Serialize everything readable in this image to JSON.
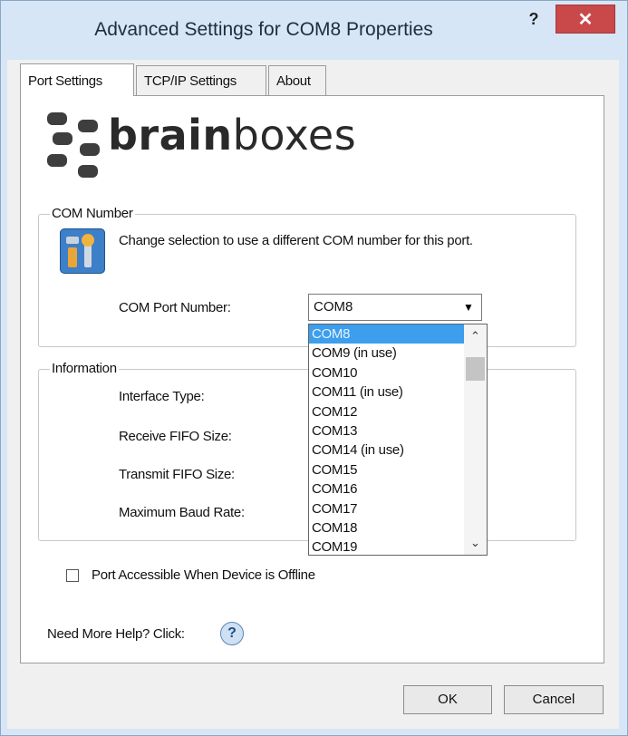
{
  "window": {
    "title": "Advanced Settings for COM8 Properties",
    "help_label": "?",
    "close_label": "✕"
  },
  "tabs": [
    {
      "label": "Port Settings"
    },
    {
      "label": "TCP/IP Settings"
    },
    {
      "label": "About"
    }
  ],
  "logo": {
    "text_bold": "brain",
    "text_light": "boxes"
  },
  "com_group": {
    "label": "COM Number",
    "description": "Change selection to use a different COM number for this port.",
    "port_label": "COM Port Number:",
    "selected_port": "COM8",
    "options": [
      "COM8",
      "COM9 (in use)",
      "COM10",
      "COM11 (in use)",
      "COM12",
      "COM13",
      "COM14 (in use)",
      "COM15",
      "COM16",
      "COM17",
      "COM18",
      "COM19"
    ]
  },
  "info_group": {
    "label": "Information",
    "interface_type": "Interface Type:",
    "receive_fifo": "Receive FIFO Size:",
    "transmit_fifo": "Transmit FIFO Size:",
    "max_baud": "Maximum Baud Rate:"
  },
  "offline_checkbox": {
    "label": "Port Accessible When Device is Offline",
    "checked": false
  },
  "help_link": {
    "label": "Need More Help? Click:"
  },
  "buttons": {
    "ok": "OK",
    "cancel": "Cancel"
  }
}
